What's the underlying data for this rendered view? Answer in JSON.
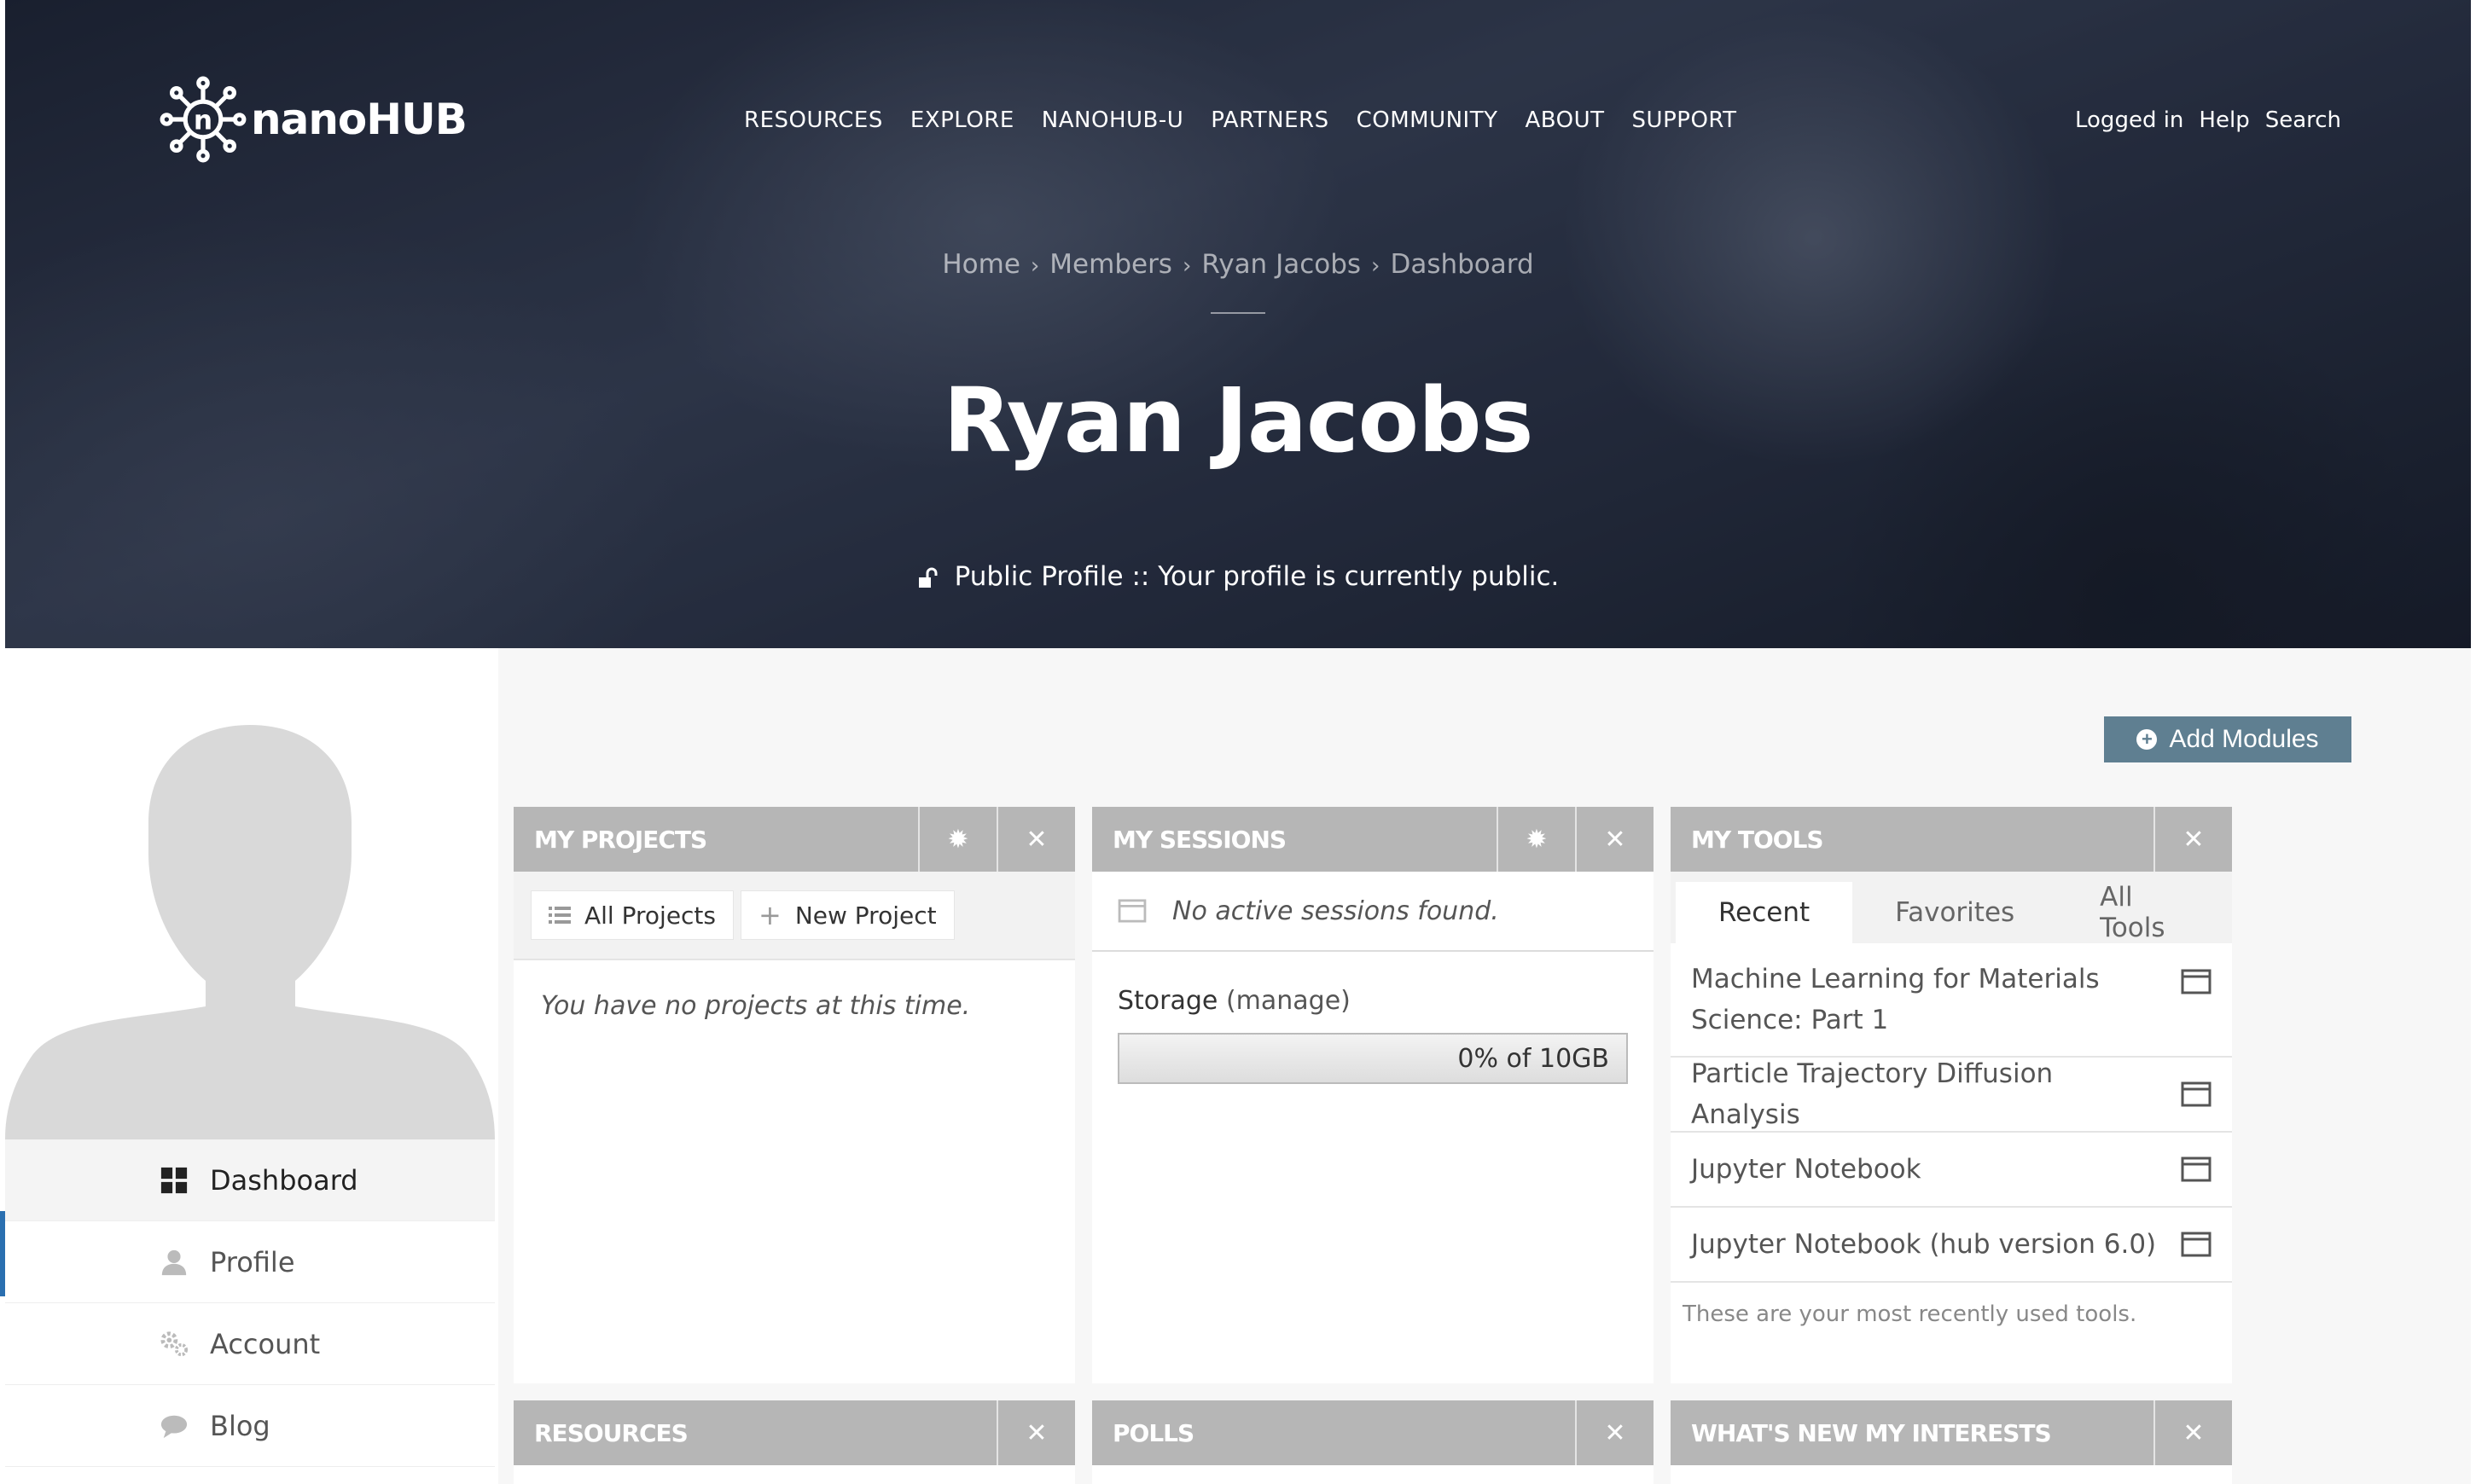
{
  "brand": {
    "name": "nanoHUB"
  },
  "main_nav": [
    "RESOURCES",
    "EXPLORE",
    "NANOHUB-U",
    "PARTNERS",
    "COMMUNITY",
    "ABOUT",
    "SUPPORT"
  ],
  "user_nav": [
    "Logged in",
    "Help",
    "Search"
  ],
  "breadcrumb": [
    "Home",
    "Members",
    "Ryan Jacobs",
    "Dashboard"
  ],
  "breadcrumb_sep": "›",
  "page_title": "Ryan Jacobs",
  "public_profile": "Public Profile :: Your profile is currently public.",
  "sidebar": {
    "items": [
      {
        "label": "Dashboard",
        "icon": "dashboard-icon",
        "active": true
      },
      {
        "label": "Profile",
        "icon": "person-icon",
        "active": false
      },
      {
        "label": "Account",
        "icon": "gears-icon",
        "active": false
      },
      {
        "label": "Blog",
        "icon": "speech-bubble-icon",
        "active": false
      }
    ]
  },
  "add_modules_label": "Add Modules",
  "modules": {
    "projects": {
      "title": "MY PROJECTS",
      "all_projects": "All Projects",
      "new_project": "New Project",
      "empty": "You have no projects at this time."
    },
    "sessions": {
      "title": "MY SESSIONS",
      "empty": "No active sessions found.",
      "storage_label": "Storage",
      "storage_manage": "(manage)",
      "storage_value": "0% of 10GB",
      "storage_percent": 0
    },
    "tools": {
      "title": "MY TOOLS",
      "tabs": [
        "Recent",
        "Favorites",
        "All Tools"
      ],
      "items": [
        "Machine Learning for Materials Science: Part 1",
        "Particle Trajectory Diffusion Analysis",
        "Jupyter Notebook",
        "Jupyter Notebook (hub version 6.0)"
      ],
      "note": "These are your most recently used tools."
    },
    "resources": {
      "title": "RESOURCES"
    },
    "polls": {
      "title": "POLLS"
    },
    "whats_new": {
      "title": "WHAT'S NEW MY INTERESTS"
    }
  },
  "icons": {
    "settings": "gear-icon",
    "close": "close-icon"
  },
  "colors": {
    "module_header": "#b6b6b6",
    "add_modules": "#5f7f91",
    "page_bg": "#f7f7f7"
  }
}
